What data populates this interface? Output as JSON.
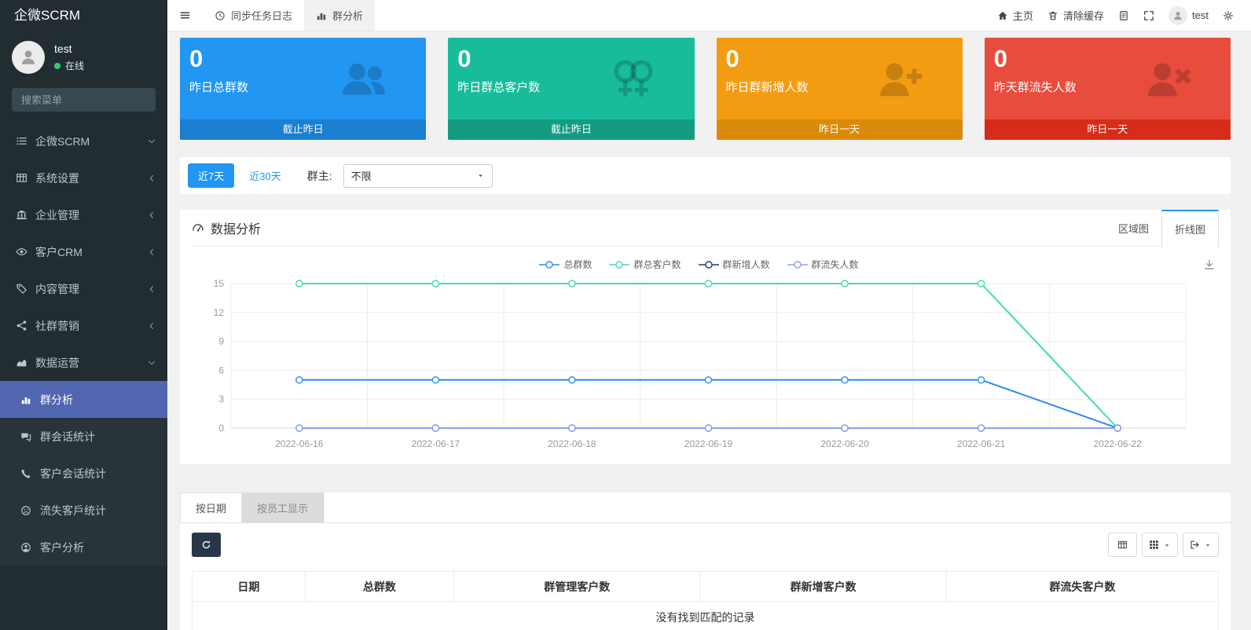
{
  "app": {
    "brand": "企微SCRM"
  },
  "sidebar": {
    "user": {
      "name": "test",
      "status": "在线"
    },
    "search": {
      "placeholder": "搜索菜单"
    },
    "menu": [
      {
        "label": "企微SCRM",
        "icon": "list",
        "arrow": "angle-down"
      },
      {
        "label": "系统设置",
        "icon": "table",
        "arrow": "angle-left"
      },
      {
        "label": "企业管理",
        "icon": "bank",
        "arrow": "angle-left"
      },
      {
        "label": "客户CRM",
        "icon": "eye",
        "arrow": "angle-left"
      },
      {
        "label": "内容管理",
        "icon": "tags",
        "arrow": "angle-left"
      },
      {
        "label": "社群营销",
        "icon": "share",
        "arrow": "angle-left"
      },
      {
        "label": "数据运营",
        "icon": "area-chart",
        "arrow": "angle-down"
      }
    ],
    "submenu": [
      {
        "label": "群分析",
        "icon": "chart-bar",
        "active": true
      },
      {
        "label": "群会话统计",
        "icon": "comments",
        "active": false
      },
      {
        "label": "客户会话统计",
        "icon": "phone",
        "active": false
      },
      {
        "label": "流失客戶统计",
        "icon": "frown",
        "active": false
      },
      {
        "label": "客户分析",
        "icon": "user-circle",
        "active": false
      }
    ]
  },
  "topbar": {
    "tabs": [
      {
        "label": "同步任务日志",
        "icon": "clock",
        "active": false
      },
      {
        "label": "群分析",
        "icon": "chart-bar",
        "active": true
      }
    ],
    "home_label": "主页",
    "clear_cache_label": "清除缓存",
    "username": "test"
  },
  "stat_cards": [
    {
      "value": "0",
      "label": "昨日总群数",
      "footer": "截止昨日",
      "icon": "users",
      "bg": "#2196f3",
      "footer_bg": "#1b7fd1"
    },
    {
      "value": "0",
      "label": "昨日群总客户数",
      "footer": "截止昨日",
      "icon": "venus-double",
      "bg": "#18bc9c",
      "footer_bg": "#149c82"
    },
    {
      "value": "0",
      "label": "昨日群新增人数",
      "footer": "昨日一天",
      "icon": "user-plus",
      "bg": "#f39c12",
      "footer_bg": "#db8b0b"
    },
    {
      "value": "0",
      "label": "昨天群流失人数",
      "footer": "昨日一天",
      "icon": "user-times",
      "bg": "#e74c3c",
      "footer_bg": "#d62c1a"
    }
  ],
  "filter_bar": {
    "range_buttons": [
      {
        "label": "近7天",
        "active": true
      },
      {
        "label": "近30天",
        "active": false
      }
    ],
    "owner_label": "群主:",
    "owner_select_value": "不限"
  },
  "analysis_panel": {
    "title": "数据分析",
    "chart_tabs": [
      {
        "label": "区域图",
        "active": false
      },
      {
        "label": "折线图",
        "active": true
      }
    ]
  },
  "chart_data": {
    "type": "line",
    "x": [
      "2022-06-16",
      "2022-06-17",
      "2022-06-18",
      "2022-06-19",
      "2022-06-20",
      "2022-06-21",
      "2022-06-22"
    ],
    "series": [
      {
        "name": "总群数",
        "color": "#2d8cf0",
        "values": [
          5,
          5,
          5,
          5,
          5,
          5,
          0
        ]
      },
      {
        "name": "群总客户数",
        "color": "#43d9b8",
        "values": [
          15,
          15,
          15,
          15,
          15,
          15,
          0
        ]
      },
      {
        "name": "群新增人数",
        "color": "#223a70",
        "values": [
          0,
          0,
          0,
          0,
          0,
          0,
          0
        ]
      },
      {
        "name": "群流失人数",
        "color": "#8f9ff3",
        "values": [
          0,
          0,
          0,
          0,
          0,
          0,
          0
        ]
      }
    ],
    "ylim": [
      0,
      15
    ],
    "yticks": [
      0,
      3,
      6,
      9,
      12,
      15
    ],
    "grid": true,
    "legend_position": "top"
  },
  "table_panel": {
    "tabs": [
      {
        "label": "按日期",
        "active": true
      },
      {
        "label": "按员工显示",
        "active": false
      }
    ],
    "columns": [
      "日期",
      "总群数",
      "群管理客户数",
      "群新增客户数",
      "群流失客户数"
    ],
    "empty_text": "没有找到匹配的记录"
  },
  "colors": {
    "sidebar_bg": "#222d32",
    "sidebar_active": "#5265b0",
    "accent_blue": "#2196f3",
    "page_bg": "#f1f1f1"
  }
}
